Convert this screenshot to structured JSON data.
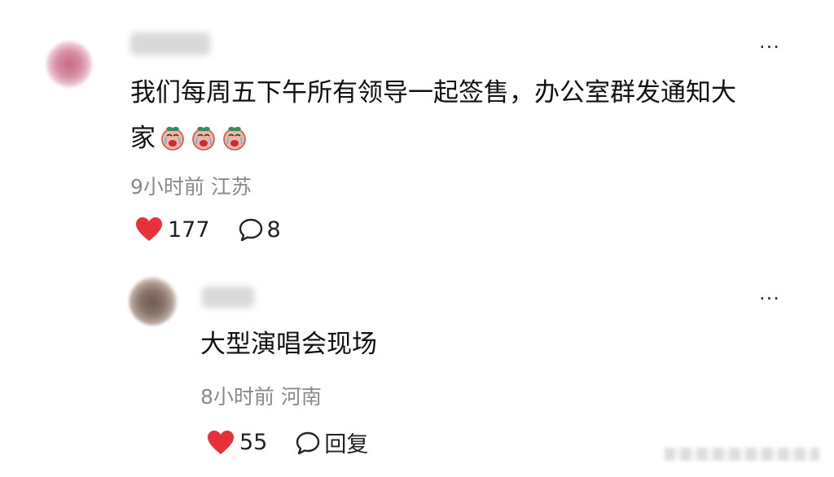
{
  "comments": [
    {
      "text_line1": "我们每周五下午所有领导一起签售，办公室群发通知大",
      "text_line2": "家",
      "emojis": [
        "crying-face-icon",
        "crying-face-icon",
        "crying-face-icon"
      ],
      "time": "9小时前",
      "location": "江苏",
      "likes": "177",
      "replies": "8"
    },
    {
      "text_line1": "大型演唱会现场",
      "time": "8小时前",
      "location": "河南",
      "likes": "55",
      "reply_label": "回复"
    }
  ],
  "more_label": "···",
  "colors": {
    "heart": "#e8303a",
    "meta": "#8a8a8a",
    "text": "#111111"
  }
}
